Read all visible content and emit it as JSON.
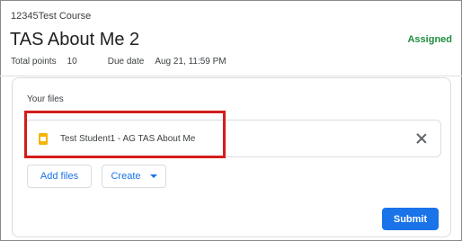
{
  "course": {
    "name": "12345Test Course"
  },
  "assignment": {
    "title": "TAS About Me 2",
    "status": "Assigned",
    "total_points_label": "Total points",
    "total_points_value": "10",
    "due_label": "Due date",
    "due_value": "Aug 21, 11:59 PM"
  },
  "files_card": {
    "header": "Your files",
    "file": {
      "name": "Test Student1 - AG TAS About Me",
      "icon": "slides-icon"
    },
    "add_files_label": "Add files",
    "create_label": "Create",
    "submit_label": "Submit"
  },
  "colors": {
    "accent": "#1a73e8",
    "status_green": "#1e8e3e",
    "highlight_red": "#d51c1c",
    "slides_yellow": "#f4b400"
  }
}
